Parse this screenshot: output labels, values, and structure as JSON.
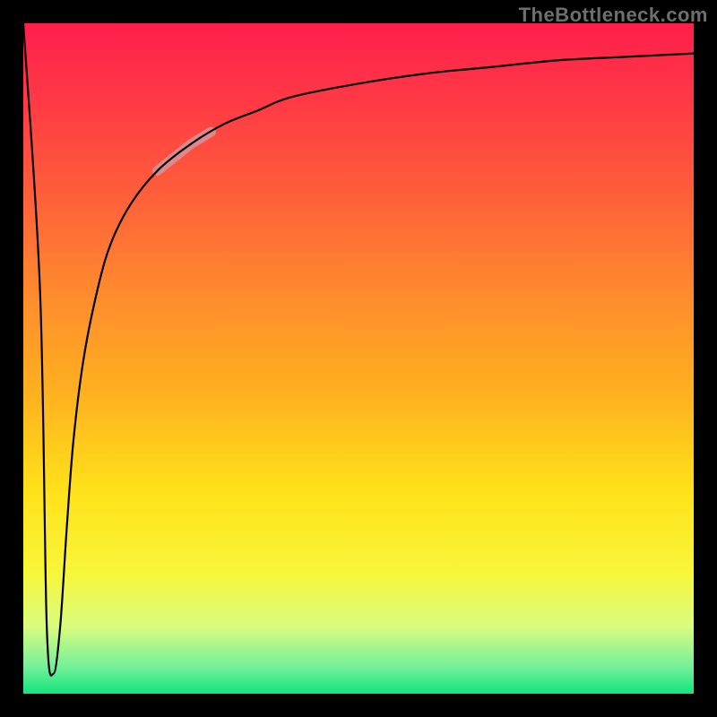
{
  "watermark": {
    "text": "TheBottleneck.com"
  },
  "colors": {
    "frame": "#000000",
    "gradient_top": "#ff1e4b",
    "gradient_bottom": "#11e57e",
    "curve": "#000000",
    "highlight": "#d88f95",
    "watermark": "#6e6e6e"
  },
  "chart_data": {
    "type": "line",
    "title": "",
    "xlabel": "",
    "ylabel": "",
    "xlim": [
      0,
      100
    ],
    "ylim": [
      0,
      100
    ],
    "grid": false,
    "legend": false,
    "series": [
      {
        "name": "bottleneck-curve",
        "x": [
          0,
          2.5,
          3.5,
          4.5,
          5.5,
          6.5,
          7.5,
          9,
          11,
          13,
          16,
          20,
          25,
          30,
          35,
          40,
          50,
          60,
          70,
          80,
          90,
          100
        ],
        "y": [
          100,
          60,
          10,
          3,
          10,
          25,
          38,
          50,
          60,
          67,
          73,
          78,
          82,
          85,
          87,
          89,
          91,
          92.5,
          93.5,
          94.5,
          95,
          95.5
        ]
      }
    ],
    "highlight_segment": {
      "series": "bottleneck-curve",
      "x_start": 20,
      "x_end": 28
    },
    "background_gradient": {
      "orientation": "vertical",
      "stops": [
        {
          "pos": 0.0,
          "color": "#ff1e4b"
        },
        {
          "pos": 0.12,
          "color": "#ff3a45"
        },
        {
          "pos": 0.25,
          "color": "#ff5d3a"
        },
        {
          "pos": 0.4,
          "color": "#ff8a2e"
        },
        {
          "pos": 0.55,
          "color": "#ffb01f"
        },
        {
          "pos": 0.7,
          "color": "#ffe21a"
        },
        {
          "pos": 0.82,
          "color": "#f8f63a"
        },
        {
          "pos": 0.9,
          "color": "#dafc7e"
        },
        {
          "pos": 0.96,
          "color": "#74f09a"
        },
        {
          "pos": 1.0,
          "color": "#11e57e"
        }
      ]
    }
  }
}
